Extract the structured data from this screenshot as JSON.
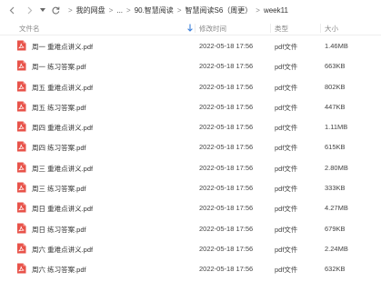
{
  "breadcrumb": {
    "items": [
      "我的网盘",
      "...",
      "90.智慧阅读",
      "智慧阅读S6（周更）",
      "week11"
    ],
    "separator": ">"
  },
  "columns": {
    "name": "文件名",
    "date": "修改时间",
    "type": "类型",
    "size": "大小"
  },
  "accent_color": "#e8534a",
  "files": [
    {
      "name": "周一 重难点讲义.pdf",
      "date": "2022-05-18 17:56",
      "type": "pdf文件",
      "size": "1.46MB"
    },
    {
      "name": "周一 练习答案.pdf",
      "date": "2022-05-18 17:56",
      "type": "pdf文件",
      "size": "663KB"
    },
    {
      "name": "周五 重难点讲义.pdf",
      "date": "2022-05-18 17:56",
      "type": "pdf文件",
      "size": "802KB"
    },
    {
      "name": "周五 练习答案.pdf",
      "date": "2022-05-18 17:56",
      "type": "pdf文件",
      "size": "447KB"
    },
    {
      "name": "周四 重难点讲义.pdf",
      "date": "2022-05-18 17:56",
      "type": "pdf文件",
      "size": "1.11MB"
    },
    {
      "name": "周四 练习答案.pdf",
      "date": "2022-05-18 17:56",
      "type": "pdf文件",
      "size": "615KB"
    },
    {
      "name": "周三 重难点讲义.pdf",
      "date": "2022-05-18 17:56",
      "type": "pdf文件",
      "size": "2.80MB"
    },
    {
      "name": "周三 练习答案.pdf",
      "date": "2022-05-18 17:56",
      "type": "pdf文件",
      "size": "333KB"
    },
    {
      "name": "周日 重难点讲义.pdf",
      "date": "2022-05-18 17:56",
      "type": "pdf文件",
      "size": "4.27MB"
    },
    {
      "name": "周日 练习答案.pdf",
      "date": "2022-05-18 17:56",
      "type": "pdf文件",
      "size": "679KB"
    },
    {
      "name": "周六 重难点讲义.pdf",
      "date": "2022-05-18 17:56",
      "type": "pdf文件",
      "size": "2.24MB"
    },
    {
      "name": "周六 练习答案.pdf",
      "date": "2022-05-18 17:56",
      "type": "pdf文件",
      "size": "632KB"
    }
  ]
}
